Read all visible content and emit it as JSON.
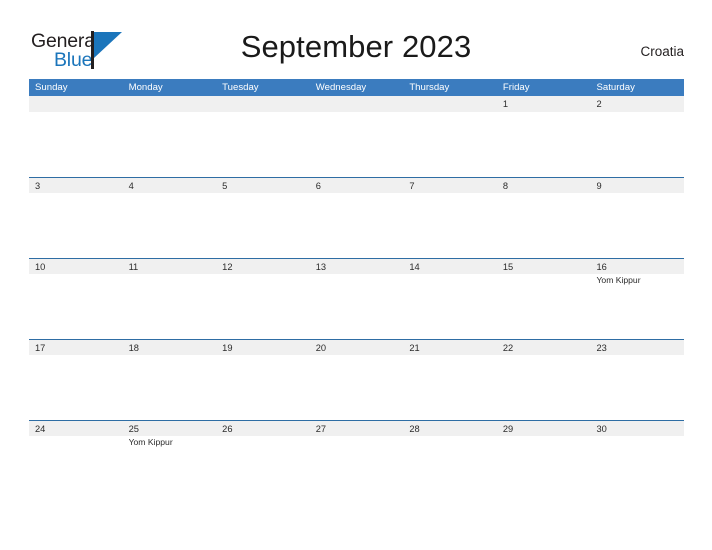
{
  "brand": {
    "name_part1": "General",
    "name_part2": "Blue",
    "flag_icon": "blue-flag-triangle-icon"
  },
  "header": {
    "title": "September 2023",
    "country": "Croatia"
  },
  "colors": {
    "header_blue": "#3b7cbf",
    "row_divider_blue": "#2e6da4",
    "date_band_gray": "#f0f0f0",
    "brand_blue": "#1b75bb",
    "text_dark": "#231f20"
  },
  "calendar": {
    "weekdays": [
      "Sunday",
      "Monday",
      "Tuesday",
      "Wednesday",
      "Thursday",
      "Friday",
      "Saturday"
    ],
    "weeks": [
      {
        "days": [
          {
            "num": "",
            "events": []
          },
          {
            "num": "",
            "events": []
          },
          {
            "num": "",
            "events": []
          },
          {
            "num": "",
            "events": []
          },
          {
            "num": "",
            "events": []
          },
          {
            "num": "1",
            "events": []
          },
          {
            "num": "2",
            "events": []
          }
        ]
      },
      {
        "days": [
          {
            "num": "3",
            "events": []
          },
          {
            "num": "4",
            "events": []
          },
          {
            "num": "5",
            "events": []
          },
          {
            "num": "6",
            "events": []
          },
          {
            "num": "7",
            "events": []
          },
          {
            "num": "8",
            "events": []
          },
          {
            "num": "9",
            "events": []
          }
        ]
      },
      {
        "days": [
          {
            "num": "10",
            "events": []
          },
          {
            "num": "11",
            "events": []
          },
          {
            "num": "12",
            "events": []
          },
          {
            "num": "13",
            "events": []
          },
          {
            "num": "14",
            "events": []
          },
          {
            "num": "15",
            "events": []
          },
          {
            "num": "16",
            "events": [
              "Yom Kippur"
            ]
          }
        ]
      },
      {
        "days": [
          {
            "num": "17",
            "events": []
          },
          {
            "num": "18",
            "events": []
          },
          {
            "num": "19",
            "events": []
          },
          {
            "num": "20",
            "events": []
          },
          {
            "num": "21",
            "events": []
          },
          {
            "num": "22",
            "events": []
          },
          {
            "num": "23",
            "events": []
          }
        ]
      },
      {
        "days": [
          {
            "num": "24",
            "events": []
          },
          {
            "num": "25",
            "events": [
              "Yom Kippur"
            ]
          },
          {
            "num": "26",
            "events": []
          },
          {
            "num": "27",
            "events": []
          },
          {
            "num": "28",
            "events": []
          },
          {
            "num": "29",
            "events": []
          },
          {
            "num": "30",
            "events": []
          }
        ]
      }
    ]
  }
}
